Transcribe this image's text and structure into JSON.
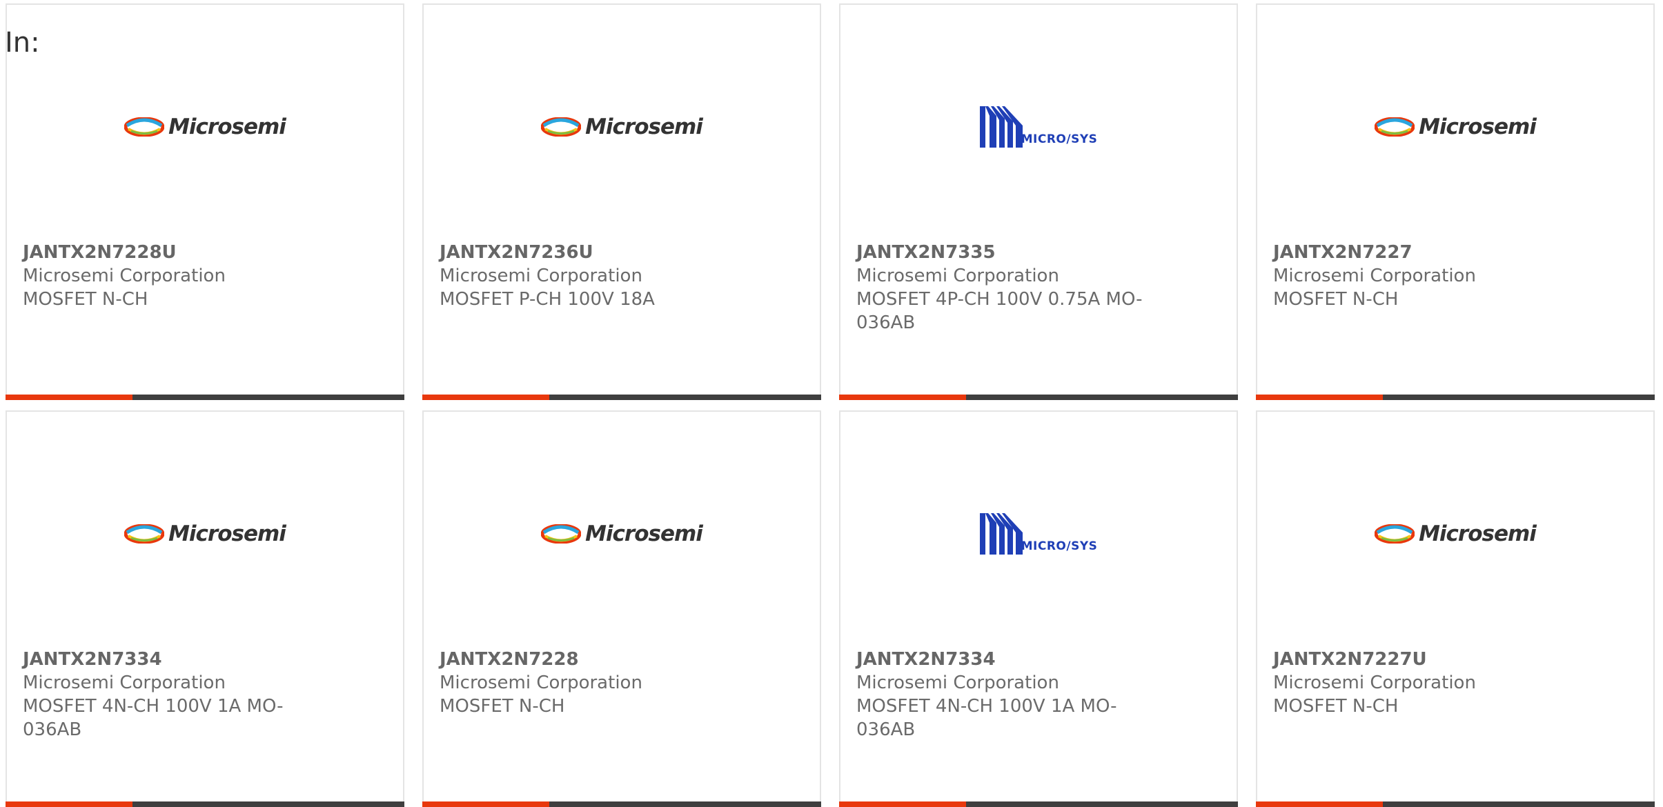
{
  "header": {
    "in_label": "In:"
  },
  "products": [
    {
      "part": "JANTX2N7228U",
      "manufacturer": "Microsemi Corporation",
      "description": "MOSFET N-CH",
      "logo": "microsemi-logo",
      "logo_text": "Microsemi"
    },
    {
      "part": "JANTX2N7236U",
      "manufacturer": "Microsemi Corporation",
      "description": "MOSFET P-CH 100V 18A",
      "logo": "microsemi-logo",
      "logo_text": "Microsemi"
    },
    {
      "part": "JANTX2N7335",
      "manufacturer": "Microsemi Corporation",
      "description": "MOSFET 4P-CH 100V 0.75A MO-036AB",
      "logo": "microsys-logo",
      "logo_text": "MICRO/SYS"
    },
    {
      "part": "JANTX2N7227",
      "manufacturer": "Microsemi Corporation",
      "description": "MOSFET N-CH",
      "logo": "microsemi-logo",
      "logo_text": "Microsemi"
    },
    {
      "part": "JANTX2N7334",
      "manufacturer": "Microsemi Corporation",
      "description": "MOSFET 4N-CH 100V 1A MO-036AB",
      "logo": "microsemi-logo",
      "logo_text": "Microsemi"
    },
    {
      "part": "JANTX2N7228",
      "manufacturer": "Microsemi Corporation",
      "description": "MOSFET N-CH",
      "logo": "microsemi-logo",
      "logo_text": "Microsemi"
    },
    {
      "part": "JANTX2N7334",
      "manufacturer": "Microsemi Corporation",
      "description": "MOSFET 4N-CH 100V 1A MO-036AB",
      "logo": "microsys-logo",
      "logo_text": "MICRO/SYS"
    },
    {
      "part": "JANTX2N7227U",
      "manufacturer": "Microsemi Corporation",
      "description": "MOSFET N-CH",
      "logo": "microsemi-logo",
      "logo_text": "Microsemi"
    }
  ],
  "colors": {
    "accent": "#e8380d",
    "bar": "#3f3f3f",
    "card_border": "#e4e4e4",
    "text": "#6a6a6a",
    "microsys_blue": "#1f3fb6"
  }
}
